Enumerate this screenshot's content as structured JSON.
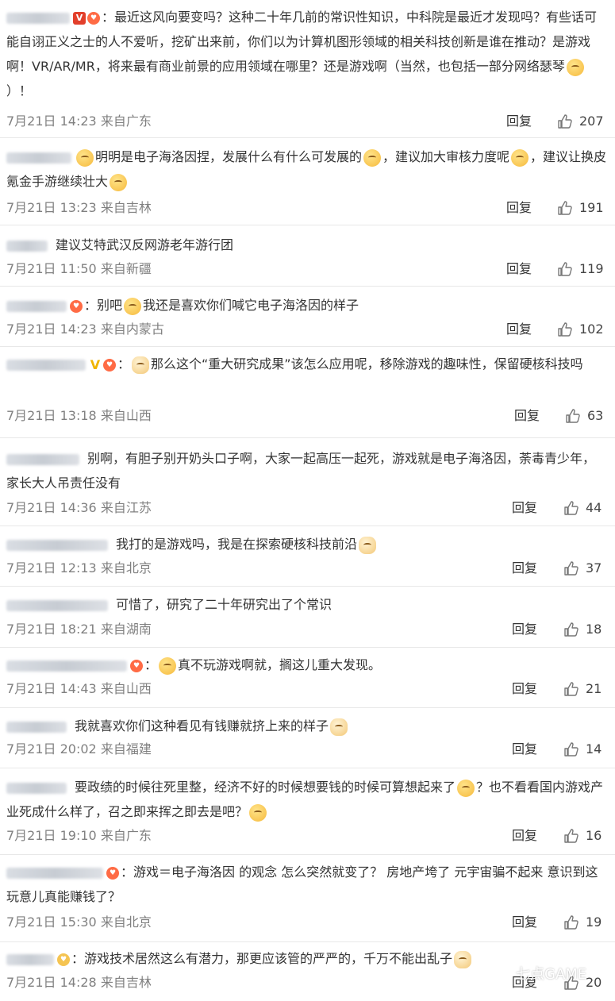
{
  "comments": [
    {
      "text": "最近这风向要变吗？这种二十年几前的常识性知识，中科院是最近才发现吗？有些话可能自诩正义之士的人不爱听，挖矿出来前，你们以为计算机图形领域的相关科技创新是谁在推动？是游戏啊！VR/AR/MR，将来最有商业前景的应用领域在哪里？还是游戏啊（当然，也包括一部分网络瑟琴",
      "text_tail": "）！",
      "time": "7月21日 14:23 来自广东",
      "reply": "回复",
      "likes": "207"
    },
    {
      "text_a": "明明是电子海洛因捏，发展什么有什么可发展的",
      "text_b": "，建议加大审核力度呢",
      "text_c": "，建议让换皮氪金手游继续壮大",
      "time": "7月21日 13:23 来自吉林",
      "reply": "回复",
      "likes": "191"
    },
    {
      "text": "建议艾特武汉反网游老年游行团",
      "time": "7月21日 11:50 来自新疆",
      "reply": "回复",
      "likes": "119"
    },
    {
      "text_a": "别吧",
      "text_b": "我还是喜欢你们喊它电子海洛因的样子",
      "time": "7月21日 14:23 来自内蒙古",
      "reply": "回复",
      "likes": "102"
    },
    {
      "text": "那么这个“重大研究成果”该怎么应用呢，移除游戏的趣味性，保留硬核科技吗",
      "time": "7月21日 13:18 来自山西",
      "reply": "回复",
      "likes": "63"
    },
    {
      "text": "别啊，有胆子别开奶头口子啊，大家一起高压一起死，游戏就是电子海洛因，荼毒青少年，家长大人吊责任没有",
      "time": "7月21日 14:36 来自江苏",
      "reply": "回复",
      "likes": "44"
    },
    {
      "text": "我打的是游戏吗，我是在探索硬核科技前沿",
      "time": "7月21日 12:13 来自北京",
      "reply": "回复",
      "likes": "37"
    },
    {
      "text": "可惜了，研究了二十年研究出了个常识",
      "time": "7月21日 18:21 来自湖南",
      "reply": "回复",
      "likes": "18"
    },
    {
      "text": "真不玩游戏啊就，搁这儿重大发现。",
      "time": "7月21日 14:43 来自山西",
      "reply": "回复",
      "likes": "21"
    },
    {
      "text": "我就喜欢你们这种看见有钱赚就挤上来的样子",
      "time": "7月21日 20:02 来自福建",
      "reply": "回复",
      "likes": "14"
    },
    {
      "text_a": "要政绩的时候往死里整，经济不好的时候想要钱的时候可算想起来了",
      "text_b": "？也不看看国内游戏产业死成什么样了，召之即来挥之即去是吧？",
      "time": "7月21日 19:10 来自广东",
      "reply": "回复",
      "likes": "16"
    },
    {
      "text": "游戏＝电子海洛因 的观念 怎么突然就变了？ 房地产垮了 元宇宙骗不起来 意识到这玩意儿真能赚钱了？",
      "time": "7月21日 15:30 来自北京",
      "reply": "回复",
      "likes": "19"
    },
    {
      "text": "游戏技术居然这么有潜力，那更应该管的严严的，千万不能出乱子",
      "time": "7月21日 14:28 来自吉林",
      "reply": "回复",
      "likes": "20"
    }
  ],
  "watermark": "七点GAME",
  "icons": {
    "like": "thumbs-up-icon",
    "verified": "verified-v-icon",
    "fan": "fan-badge-icon",
    "emoji": "emoji-icon"
  }
}
